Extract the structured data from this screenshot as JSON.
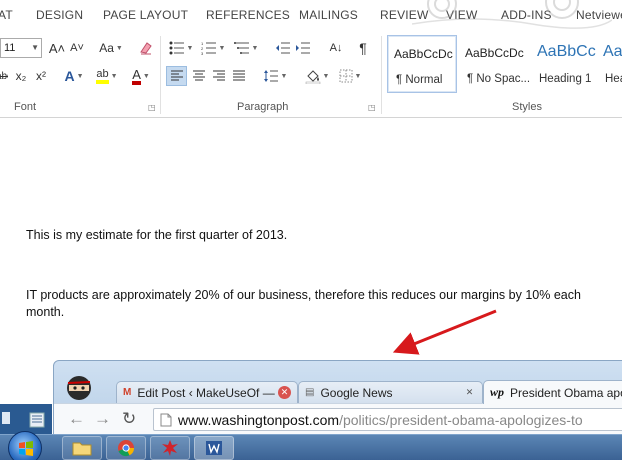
{
  "ribbon_tabs": [
    "AT",
    "DESIGN",
    "PAGE LAYOUT",
    "REFERENCES",
    "MAILINGS",
    "REVIEW",
    "VIEW",
    "ADD-INS",
    "Netviewer"
  ],
  "font_group": {
    "label": "Font",
    "size_value": "11",
    "grow_glyph": "A˄",
    "shrink_glyph": "A˅",
    "case_glyph": "Aa",
    "strike_glyph": "abc",
    "sub_glyph": "x₂",
    "sup_glyph": "x²",
    "effects_glyph": "A",
    "highlight_glyph": "ab",
    "color_glyph": "A"
  },
  "paragraph_group": {
    "label": "Paragraph",
    "sort_glyph": "A↓",
    "pilcrow_glyph": "¶"
  },
  "styles_group": {
    "label": "Styles",
    "items": [
      {
        "sample": "AaBbCcDc",
        "name": "¶ Normal"
      },
      {
        "sample": "AaBbCcDc",
        "name": "¶ No Spac..."
      },
      {
        "sample": "AaBbCc",
        "name": "Heading 1"
      },
      {
        "sample": "AaB",
        "name": "Hea"
      }
    ]
  },
  "document": {
    "paragraphs": [
      "This is my estimate for the first quarter of 2013.",
      "IT products are approximately 20% of our business, therefore this reduces our margins by 10% each month."
    ]
  },
  "browser": {
    "tabs": [
      {
        "title": "Edit Post ‹ MakeUseOf —",
        "icon": "M"
      },
      {
        "title": "Google News",
        "icon": "▤"
      },
      {
        "title": "President Obama apo",
        "icon": "wp"
      }
    ],
    "url_host": "www.washingtonpost.com",
    "url_path": "/politics/president-obama-apologizes-to"
  },
  "colors": {
    "accent_blue": "#2b579a",
    "highlight_yellow": "#ffff00",
    "font_color_red": "#c00000",
    "arrow_red": "#d7191c"
  }
}
